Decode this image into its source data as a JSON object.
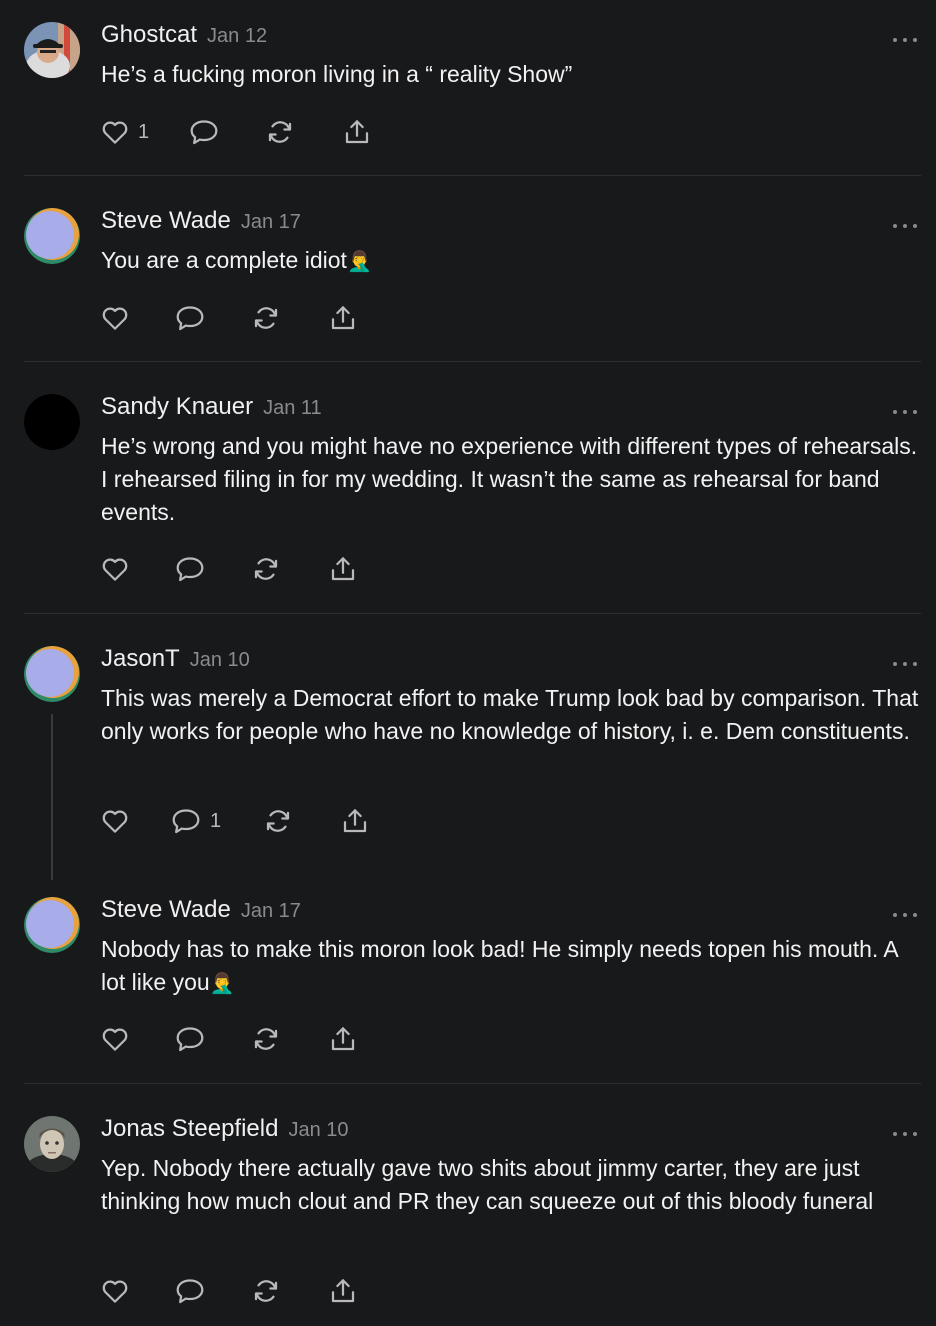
{
  "comments": [
    {
      "author": "Ghostcat",
      "date": "Jan 12",
      "text": "He’s a fucking moron living in a “ reality Show”",
      "likes": "1",
      "replies": "",
      "avatar": "photo"
    },
    {
      "author": "Steve Wade",
      "date": "Jan 17",
      "text": "You are a complete idiot",
      "emoji": "🤦‍♂️",
      "likes": "",
      "replies": "",
      "avatar": "gradient"
    },
    {
      "author": "Sandy Knauer",
      "date": "Jan 11",
      "text": "He’s wrong and you might have no experience with different types of rehearsals. I rehearsed filing in for my wedding. It wasn’t the same as rehearsal for band events.",
      "likes": "",
      "replies": "",
      "avatar": "black"
    },
    {
      "author": "JasonT",
      "date": "Jan 10",
      "text": "This was merely a Democrat effort to make Trump look bad by comparison. That only works for people who have no knowledge of history, i. e. Dem constituents.",
      "likes": "",
      "replies": "1",
      "avatar": "gradient"
    },
    {
      "author": "Steve Wade",
      "date": "Jan 17",
      "text": "Nobody has to make this moron look bad! He simply needs topen his mouth. A lot like you",
      "emoji": "🤦‍♂️",
      "likes": "",
      "replies": "",
      "avatar": "gradient"
    },
    {
      "author": "Jonas Steepfield",
      "date": "Jan 10",
      "text": "Yep. Nobody there actually gave two shits about jimmy carter, they are just thinking how much clout and PR they can squeeze out of this bloody funeral",
      "likes": "",
      "replies": "",
      "avatar": "portrait"
    }
  ],
  "icons": {
    "like": "heart-icon",
    "reply": "comment-bubble-icon",
    "restack": "restack-icon",
    "share": "share-icon",
    "more": "more-dots-icon"
  },
  "colors": {
    "background": "#18191b",
    "text": "#f2f2f2",
    "muted": "#8b8b8f",
    "divider": "#2e2f33",
    "gradient_avatar": [
      "#a8ace8",
      "#e8a13c",
      "#2e8a67"
    ]
  }
}
